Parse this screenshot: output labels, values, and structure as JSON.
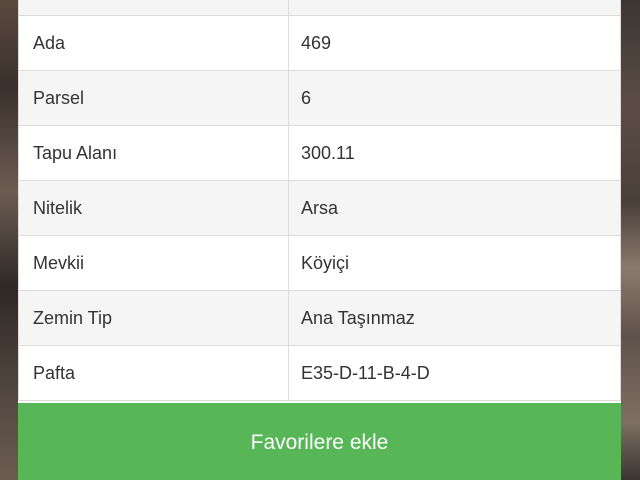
{
  "table": {
    "rows": [
      {
        "label": "",
        "value": ""
      },
      {
        "label": "Ada",
        "value": "469"
      },
      {
        "label": "Parsel",
        "value": "6"
      },
      {
        "label": "Tapu Alanı",
        "value": "300.11"
      },
      {
        "label": "Nitelik",
        "value": "Arsa"
      },
      {
        "label": "Mevkii",
        "value": "Köyiçi"
      },
      {
        "label": "Zemin Tip",
        "value": "Ana Taşınmaz"
      },
      {
        "label": "Pafta",
        "value": "E35-D-11-B-4-D"
      }
    ]
  },
  "actions": {
    "favorite_label": "Favorilere ekle"
  },
  "colors": {
    "button_green": "#57b757",
    "row_alt": "#f5f5f5",
    "border": "#dcdcdc"
  }
}
